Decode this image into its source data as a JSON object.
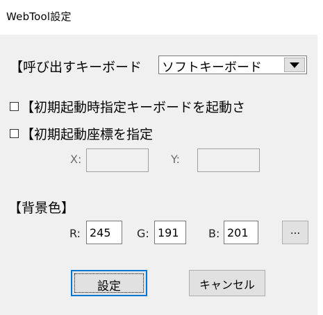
{
  "window": {
    "title": "WebTool設定"
  },
  "keyboard": {
    "label": "【呼び出すキーボード",
    "selected": "ソフトキーボード"
  },
  "startup_keyboard": {
    "label": "【初期起動時指定キーボードを起動さ",
    "checked": false
  },
  "startup_coords": {
    "label": "【初期起動座標を指定",
    "checked": false,
    "x_label": "X:",
    "y_label": "Y:",
    "x_value": "",
    "y_value": ""
  },
  "background": {
    "label": "【背景色】",
    "r_label": "R:",
    "r_value": "245",
    "g_label": "G:",
    "g_value": "191",
    "b_label": "B:",
    "b_value": "201",
    "picker_label": "..."
  },
  "buttons": {
    "ok_label": "設定",
    "cancel_label": "キャンセル"
  },
  "colors": {
    "dialog_bg": "#f0f0f0",
    "default_button_border": "#0078d7"
  }
}
